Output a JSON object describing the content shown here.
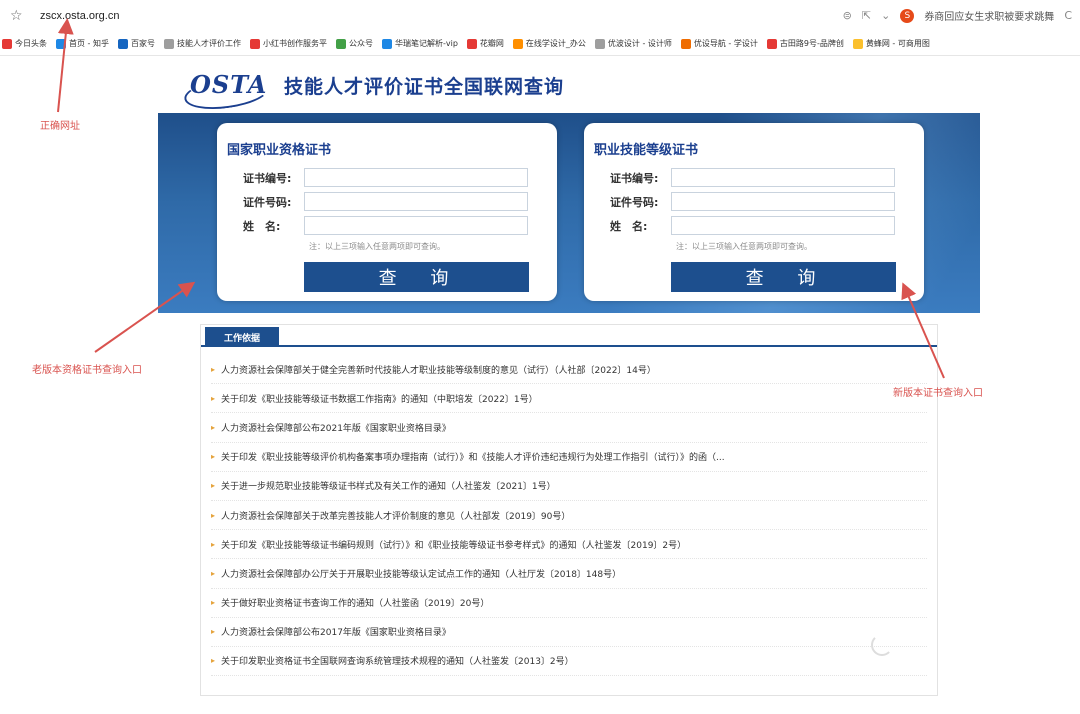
{
  "browser": {
    "url": "zscx.osta.org.cn",
    "news_text": "券商回应女生求职被要求跳舞",
    "bookmarks": [
      {
        "label": "今日头条",
        "color": "#e53935"
      },
      {
        "label": "首页 - 知乎",
        "color": "#1e88e5"
      },
      {
        "label": "百家号",
        "color": "#1565c0"
      },
      {
        "label": "技能人才评价工作",
        "color": "#9e9e9e"
      },
      {
        "label": "小红书创作服务平",
        "color": "#e53935"
      },
      {
        "label": "公众号",
        "color": "#43a047"
      },
      {
        "label": "华瑞笔记解析-vip",
        "color": "#1e88e5"
      },
      {
        "label": "花瓣网",
        "color": "#e53935"
      },
      {
        "label": "在线学设计_办公",
        "color": "#ff8f00"
      },
      {
        "label": "优波设计 - 设计师",
        "color": "#9e9e9e"
      },
      {
        "label": "优设导航 - 学设计",
        "color": "#ef6c00"
      },
      {
        "label": "古田路9号-品牌创",
        "color": "#e53935"
      },
      {
        "label": "黄蜂网 - 可商用图",
        "color": "#fbc02d"
      }
    ]
  },
  "header": {
    "logo_text": "OSTA",
    "title": "技能人才评价证书全国联网查询"
  },
  "cards": [
    {
      "title": "国家职业资格证书",
      "fields": [
        {
          "label": "证书编号:",
          "value": ""
        },
        {
          "label": "证件号码:",
          "value": ""
        },
        {
          "label": "姓　名:",
          "value": ""
        }
      ],
      "note": "注：以上三项输入任意两项即可查询。",
      "button": "查 询"
    },
    {
      "title": "职业技能等级证书",
      "fields": [
        {
          "label": "证书编号:",
          "value": ""
        },
        {
          "label": "证件号码:",
          "value": ""
        },
        {
          "label": "姓　名:",
          "value": ""
        }
      ],
      "note": "注：以上三项输入任意两项即可查询。",
      "button": "查 询"
    }
  ],
  "panel": {
    "tab": "工作依据",
    "items": [
      "人力资源社会保障部关于健全完善新时代技能人才职业技能等级制度的意见（试行）（人社部〔2022〕14号）",
      "关于印发《职业技能等级证书数据工作指南》的通知（中职培发〔2022〕1号）",
      "人力资源社会保障部公布2021年版《国家职业资格目录》",
      "关于印发《职业技能等级评价机构备案事项办理指南（试行）》和《技能人才评价违纪违规行为处理工作指引（试行）》的函（...",
      "关于进一步规范职业技能等级证书样式及有关工作的通知（人社鉴发〔2021〕1号）",
      "人力资源社会保障部关于改革完善技能人才评价制度的意见（人社部发〔2019〕90号）",
      "关于印发《职业技能等级证书编码规则（试行）》和《职业技能等级证书参考样式》的通知（人社鉴发〔2019〕2号）",
      "人力资源社会保障部办公厅关于开展职业技能等级认定试点工作的通知（人社厅发〔2018〕148号）",
      "关于做好职业资格证书查询工作的通知（人社鉴函〔2019〕20号）",
      "人力资源社会保障部公布2017年版《国家职业资格目录》",
      "关于印发职业资格证书全国联网查询系统管理技术规程的通知（人社鉴发〔2013〕2号）"
    ]
  },
  "annotations": {
    "correct_url": "正确网址",
    "old_entry": "老版本资格证书查询入口",
    "new_entry": "新版本证书查询入口"
  },
  "colors": {
    "brand_blue": "#1d4f8e",
    "annotation_red": "#d9534f"
  }
}
